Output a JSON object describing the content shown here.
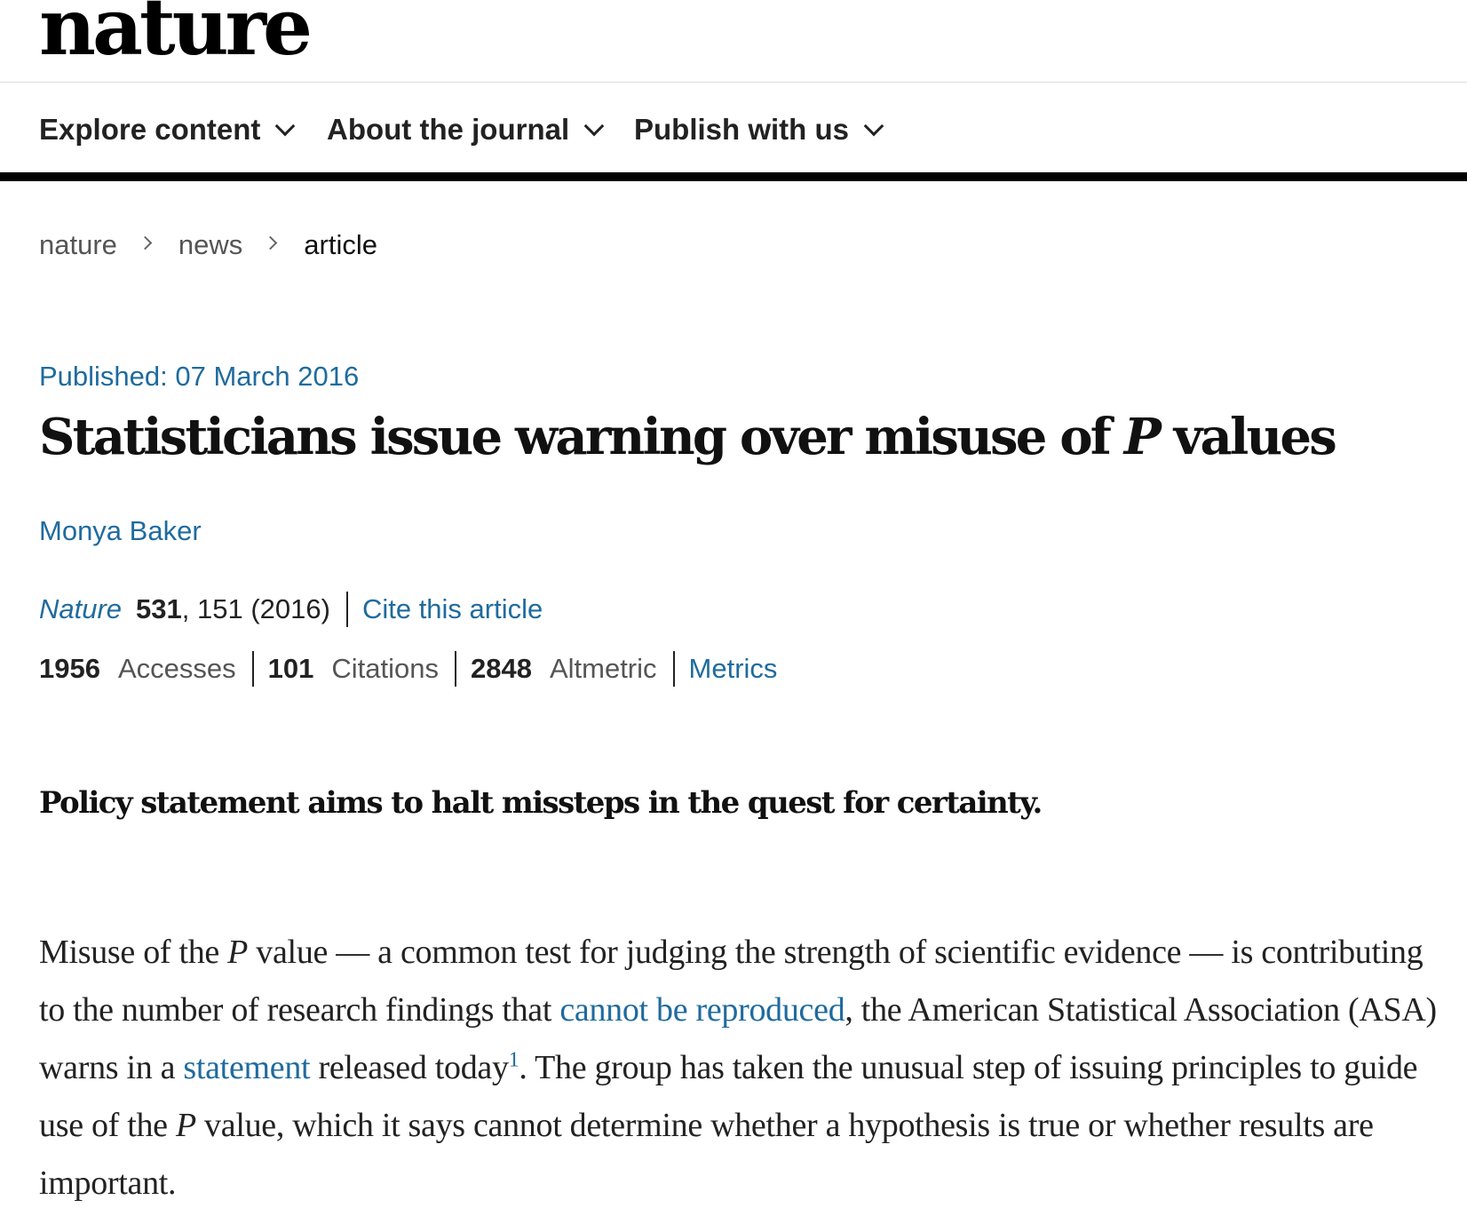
{
  "header": {
    "logo_text": "nature"
  },
  "nav": {
    "items": [
      {
        "label": "Explore content"
      },
      {
        "label": "About the journal"
      },
      {
        "label": "Publish with us"
      }
    ]
  },
  "breadcrumb": {
    "items": [
      {
        "label": "nature"
      },
      {
        "label": "news"
      },
      {
        "label": "article"
      }
    ]
  },
  "article": {
    "published_label": "Published: 07 March 2016",
    "title_part1": "Statisticians issue warning over misuse of ",
    "title_italic": "P",
    "title_part2": " values",
    "author": "Monya Baker",
    "citation": {
      "journal": "Nature",
      "volume": "531",
      "pages_year": ", 151 (2016)",
      "cite_link": "Cite this article"
    },
    "metrics": {
      "accesses_value": "1956",
      "accesses_label": "Accesses",
      "citations_value": "101",
      "citations_label": "Citations",
      "altmetric_value": "2848",
      "altmetric_label": "Altmetric",
      "metrics_link": "Metrics"
    },
    "standfirst": "Policy statement aims to halt missteps in the quest for certainty.",
    "body": {
      "s1": "Misuse of the ",
      "p1": "P",
      "s2": " value — a common test for judging the strength of scientific evidence — is contributing to the number of research findings that ",
      "link1": "cannot be reproduced",
      "s3": ", the American Statistical Association (ASA) warns in a ",
      "link2": "statement",
      "s4": " released today",
      "ref": "1",
      "s5": ". The group has taken the unusual step of issuing principles to guide use of the ",
      "p2": "P",
      "s6": " value, which it says cannot determine whether a hypothesis is true or whether results are important."
    }
  },
  "colors": {
    "link_blue": "#1f6b9e",
    "text_dark": "#222222",
    "text_muted": "#555555",
    "nav_border": "#000000"
  }
}
